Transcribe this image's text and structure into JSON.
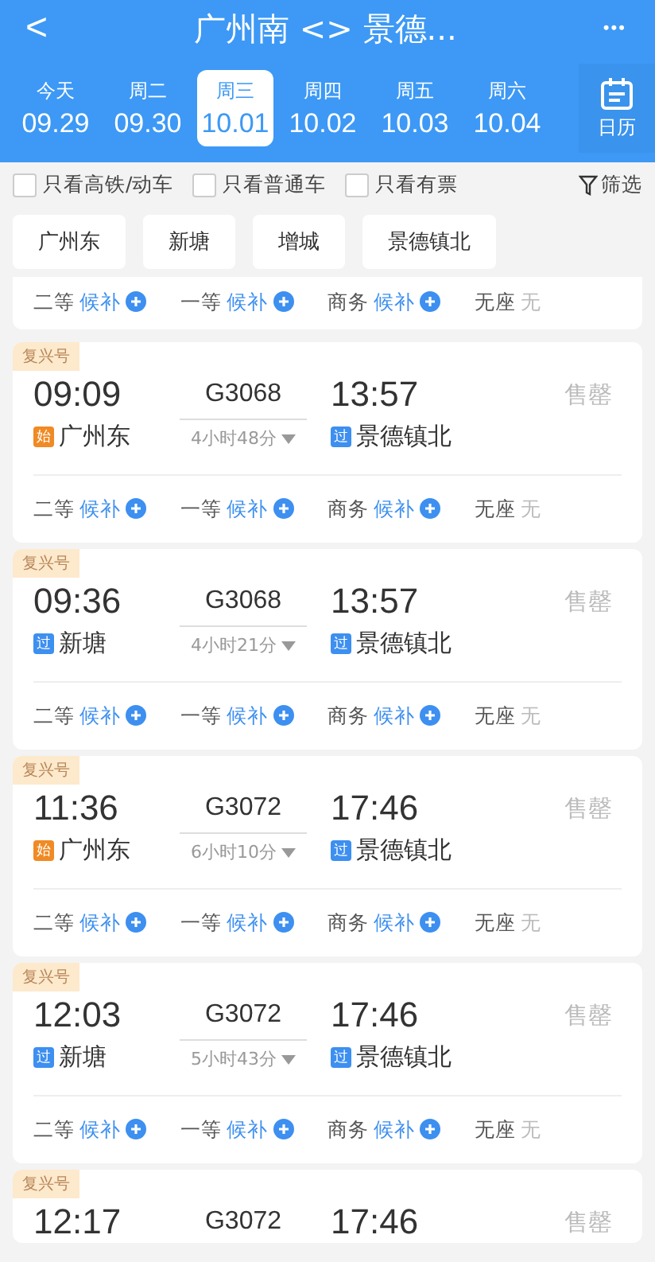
{
  "header": {
    "back": "<",
    "title": "广州南 <> 景德...",
    "more": "•••"
  },
  "dates": [
    {
      "weekday": "今天",
      "date": "09.29",
      "selected": false
    },
    {
      "weekday": "周二",
      "date": "09.30",
      "selected": false
    },
    {
      "weekday": "周三",
      "date": "10.01",
      "selected": true
    },
    {
      "weekday": "周四",
      "date": "10.02",
      "selected": false
    },
    {
      "weekday": "周五",
      "date": "10.03",
      "selected": false
    },
    {
      "weekday": "周六",
      "date": "10.04",
      "selected": false
    }
  ],
  "calendar": {
    "label": "日历"
  },
  "filters": [
    {
      "label": "只看高铁/动车",
      "checked": false
    },
    {
      "label": "只看普通车",
      "checked": false
    },
    {
      "label": "只看有票",
      "checked": false
    }
  ],
  "filter_button": "筛选",
  "station_chips": [
    "广州东",
    "新塘",
    "增城",
    "景德镇北"
  ],
  "partial_seats": [
    {
      "label": "二等",
      "status": "候补",
      "kind": "waitlist"
    },
    {
      "label": "一等",
      "status": "候补",
      "kind": "waitlist"
    },
    {
      "label": "商务",
      "status": "候补",
      "kind": "waitlist"
    },
    {
      "label": "无座",
      "status": "无",
      "kind": "none"
    }
  ],
  "trains": [
    {
      "tag": "复兴号",
      "depart": "09:09",
      "number": "G3068",
      "arrive": "13:57",
      "status": "售罄",
      "from": {
        "mark": "始",
        "kind": "start",
        "name": "广州东"
      },
      "duration": "4小时48分",
      "to": {
        "mark": "过",
        "kind": "pass",
        "name": "景德镇北"
      },
      "seats": [
        {
          "label": "二等",
          "status": "候补",
          "kind": "waitlist"
        },
        {
          "label": "一等",
          "status": "候补",
          "kind": "waitlist"
        },
        {
          "label": "商务",
          "status": "候补",
          "kind": "waitlist"
        },
        {
          "label": "无座",
          "status": "无",
          "kind": "none"
        }
      ]
    },
    {
      "tag": "复兴号",
      "depart": "09:36",
      "number": "G3068",
      "arrive": "13:57",
      "status": "售罄",
      "from": {
        "mark": "过",
        "kind": "pass",
        "name": "新塘"
      },
      "duration": "4小时21分",
      "to": {
        "mark": "过",
        "kind": "pass",
        "name": "景德镇北"
      },
      "seats": [
        {
          "label": "二等",
          "status": "候补",
          "kind": "waitlist"
        },
        {
          "label": "一等",
          "status": "候补",
          "kind": "waitlist"
        },
        {
          "label": "商务",
          "status": "候补",
          "kind": "waitlist"
        },
        {
          "label": "无座",
          "status": "无",
          "kind": "none"
        }
      ]
    },
    {
      "tag": "复兴号",
      "depart": "11:36",
      "number": "G3072",
      "arrive": "17:46",
      "status": "售罄",
      "from": {
        "mark": "始",
        "kind": "start",
        "name": "广州东"
      },
      "duration": "6小时10分",
      "to": {
        "mark": "过",
        "kind": "pass",
        "name": "景德镇北"
      },
      "seats": [
        {
          "label": "二等",
          "status": "候补",
          "kind": "waitlist"
        },
        {
          "label": "一等",
          "status": "候补",
          "kind": "waitlist"
        },
        {
          "label": "商务",
          "status": "候补",
          "kind": "waitlist"
        },
        {
          "label": "无座",
          "status": "无",
          "kind": "none"
        }
      ]
    },
    {
      "tag": "复兴号",
      "depart": "12:03",
      "number": "G3072",
      "arrive": "17:46",
      "status": "售罄",
      "from": {
        "mark": "过",
        "kind": "pass",
        "name": "新塘"
      },
      "duration": "5小时43分",
      "to": {
        "mark": "过",
        "kind": "pass",
        "name": "景德镇北"
      },
      "seats": [
        {
          "label": "二等",
          "status": "候补",
          "kind": "waitlist"
        },
        {
          "label": "一等",
          "status": "候补",
          "kind": "waitlist"
        },
        {
          "label": "商务",
          "status": "候补",
          "kind": "waitlist"
        },
        {
          "label": "无座",
          "status": "无",
          "kind": "none"
        }
      ]
    },
    {
      "tag": "复兴号",
      "depart": "12:17",
      "number": "G3072",
      "arrive": "17:46",
      "status": "售罄"
    }
  ]
}
